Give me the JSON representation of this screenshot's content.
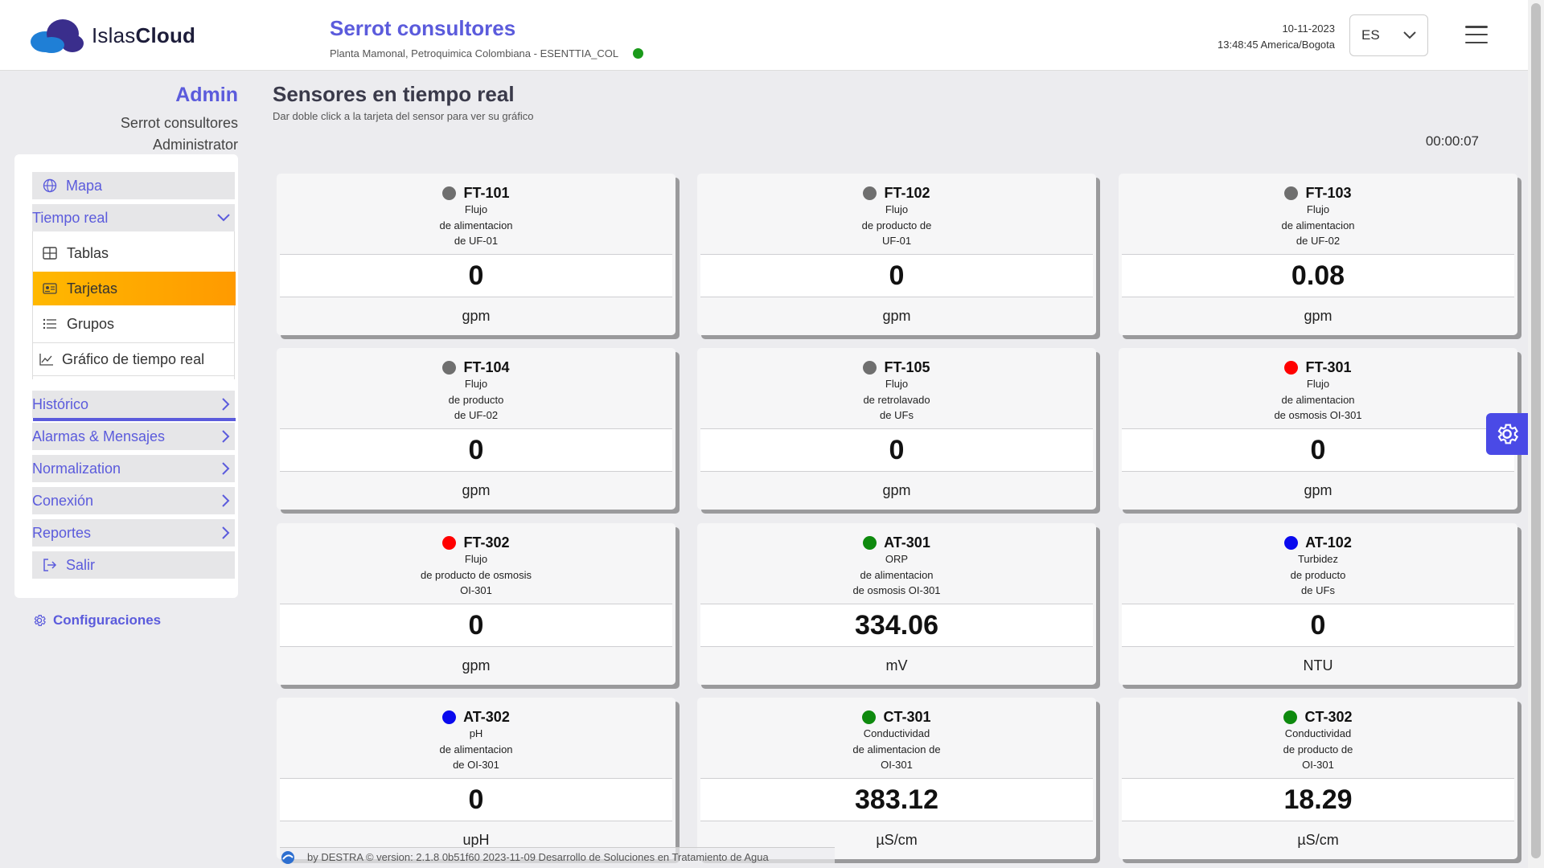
{
  "header": {
    "logo_text_light": "Islas",
    "logo_text_bold": "Cloud",
    "company_name": "Serrot consultores",
    "plant_line": "Planta Mamonal, Petroquimica Colombiana - ESENTTIA_COL",
    "date": "10-11-2023",
    "time_zone_line": "13:48:45 America/Bogota",
    "language": "ES",
    "status_color": "#1a9a1a"
  },
  "user": {
    "name": "Admin",
    "company": "Serrot consultores",
    "role": "Administrator"
  },
  "sidebar": {
    "map": "Mapa",
    "realtime": "Tiempo real",
    "tables": "Tablas",
    "cards": "Tarjetas",
    "groups": "Grupos",
    "realtime_chart": "Gráfico de tiempo real",
    "history": "Histórico",
    "alarms": "Alarmas & Mensajes",
    "normalization": "Normalization",
    "connection": "Conexión",
    "reports": "Reportes",
    "logout": "Salir",
    "settings": "Configuraciones"
  },
  "main": {
    "title": "Sensores en tiempo real",
    "subtitle": "Dar doble click a la tarjeta del sensor para ver su gráfico",
    "timer": "00:00:07"
  },
  "colors": {
    "accent": "#5b5bdc",
    "active_item": "#ffa800",
    "status_gray": "#6f6f6f",
    "status_red": "#ff0000",
    "status_green": "#0e8a0e",
    "status_blue": "#0a0aee"
  },
  "cards": [
    {
      "tag": "FT-101",
      "status_color": "#6f6f6f",
      "lines": [
        "Flujo",
        "de alimentacion",
        "de UF-01"
      ],
      "value": "0",
      "unit": "gpm"
    },
    {
      "tag": "FT-102",
      "status_color": "#6f6f6f",
      "lines": [
        "Flujo",
        "de producto de",
        "UF-01"
      ],
      "value": "0",
      "unit": "gpm"
    },
    {
      "tag": "FT-103",
      "status_color": "#6f6f6f",
      "lines": [
        "Flujo",
        "de alimentacion",
        "de UF-02"
      ],
      "value": "0.08",
      "unit": "gpm"
    },
    {
      "tag": "FT-104",
      "status_color": "#6f6f6f",
      "lines": [
        "Flujo",
        "de producto",
        "de UF-02"
      ],
      "value": "0",
      "unit": "gpm"
    },
    {
      "tag": "FT-105",
      "status_color": "#6f6f6f",
      "lines": [
        "Flujo",
        "de retrolavado",
        "de UFs"
      ],
      "value": "0",
      "unit": "gpm"
    },
    {
      "tag": "FT-301",
      "status_color": "#ff0000",
      "lines": [
        "Flujo",
        "de alimentacion",
        "de osmosis OI-301"
      ],
      "value": "0",
      "unit": "gpm"
    },
    {
      "tag": "FT-302",
      "status_color": "#ff0000",
      "lines": [
        "Flujo",
        "de producto de osmosis",
        "OI-301"
      ],
      "value": "0",
      "unit": "gpm"
    },
    {
      "tag": "AT-301",
      "status_color": "#0e8a0e",
      "lines": [
        "ORP",
        "de alimentacion",
        "de osmosis OI-301"
      ],
      "value": "334.06",
      "unit": "mV"
    },
    {
      "tag": "AT-102",
      "status_color": "#0a0aee",
      "lines": [
        "Turbidez",
        "de producto",
        "de UFs"
      ],
      "value": "0",
      "unit": "NTU"
    },
    {
      "tag": "AT-302",
      "status_color": "#0a0aee",
      "lines": [
        "pH",
        "de alimentacion",
        "de OI-301"
      ],
      "value": "0",
      "unit": "upH"
    },
    {
      "tag": "CT-301",
      "status_color": "#0e8a0e",
      "lines": [
        "Conductividad",
        "de alimentacion de",
        "OI-301"
      ],
      "value": "383.12",
      "unit": "µS/cm"
    },
    {
      "tag": "CT-302",
      "status_color": "#0e8a0e",
      "lines": [
        "Conductividad",
        "de producto de",
        "OI-301"
      ],
      "value": "18.29",
      "unit": "µS/cm"
    }
  ],
  "footer": {
    "text": "by  DESTRA ©  version: 2.1.8  0b51f60  2023-11-09     Desarrollo de Soluciones en Tratamiento de Agua"
  }
}
